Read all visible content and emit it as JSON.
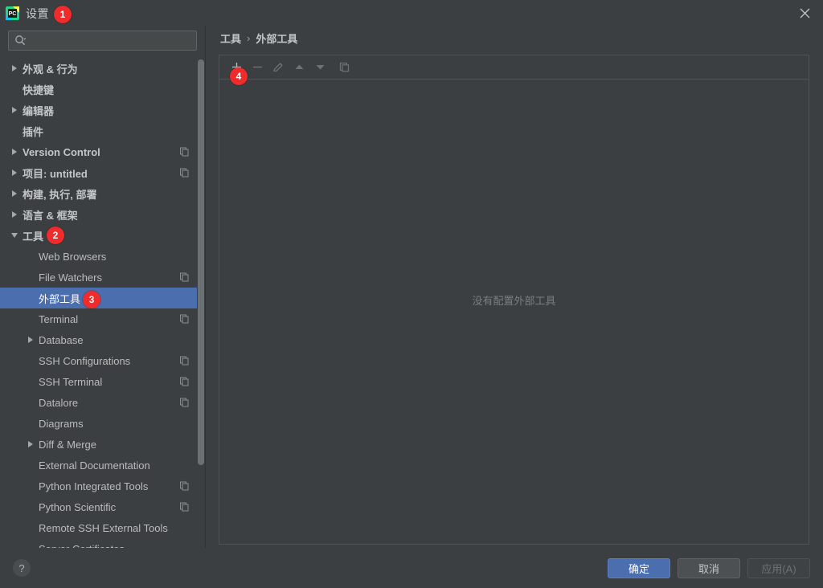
{
  "window": {
    "title": "设置",
    "app_icon": "pycharm-icon",
    "close_label": "✕"
  },
  "search": {
    "value": "",
    "placeholder": "",
    "icon": "search-icon"
  },
  "sidebar": {
    "items": [
      {
        "label": "外观 & 行为",
        "indent": 0,
        "arrow": "right",
        "bold": true,
        "copy": false,
        "selected": false
      },
      {
        "label": "快捷键",
        "indent": 0,
        "arrow": "none",
        "bold": true,
        "copy": false,
        "selected": false
      },
      {
        "label": "编辑器",
        "indent": 0,
        "arrow": "right",
        "bold": true,
        "copy": false,
        "selected": false
      },
      {
        "label": "插件",
        "indent": 0,
        "arrow": "none",
        "bold": true,
        "copy": false,
        "selected": false
      },
      {
        "label": "Version Control",
        "indent": 0,
        "arrow": "right",
        "bold": true,
        "copy": true,
        "selected": false
      },
      {
        "label": "项目: untitled",
        "indent": 0,
        "arrow": "right",
        "bold": true,
        "copy": true,
        "selected": false
      },
      {
        "label": "构建, 执行, 部署",
        "indent": 0,
        "arrow": "right",
        "bold": true,
        "copy": false,
        "selected": false
      },
      {
        "label": "语言 & 框架",
        "indent": 0,
        "arrow": "right",
        "bold": true,
        "copy": false,
        "selected": false
      },
      {
        "label": "工具",
        "indent": 0,
        "arrow": "down",
        "bold": true,
        "copy": false,
        "selected": false
      },
      {
        "label": "Web Browsers",
        "indent": 1,
        "arrow": "none",
        "bold": false,
        "copy": false,
        "selected": false
      },
      {
        "label": "File Watchers",
        "indent": 1,
        "arrow": "none",
        "bold": false,
        "copy": true,
        "selected": false
      },
      {
        "label": "外部工具",
        "indent": 1,
        "arrow": "none",
        "bold": false,
        "copy": false,
        "selected": true
      },
      {
        "label": "Terminal",
        "indent": 1,
        "arrow": "none",
        "bold": false,
        "copy": true,
        "selected": false
      },
      {
        "label": "Database",
        "indent": 1,
        "arrow": "right",
        "bold": false,
        "copy": false,
        "selected": false
      },
      {
        "label": "SSH Configurations",
        "indent": 1,
        "arrow": "none",
        "bold": false,
        "copy": true,
        "selected": false
      },
      {
        "label": "SSH Terminal",
        "indent": 1,
        "arrow": "none",
        "bold": false,
        "copy": true,
        "selected": false
      },
      {
        "label": "Datalore",
        "indent": 1,
        "arrow": "none",
        "bold": false,
        "copy": true,
        "selected": false
      },
      {
        "label": "Diagrams",
        "indent": 1,
        "arrow": "none",
        "bold": false,
        "copy": false,
        "selected": false
      },
      {
        "label": "Diff & Merge",
        "indent": 1,
        "arrow": "right",
        "bold": false,
        "copy": false,
        "selected": false
      },
      {
        "label": "External Documentation",
        "indent": 1,
        "arrow": "none",
        "bold": false,
        "copy": false,
        "selected": false
      },
      {
        "label": "Python Integrated Tools",
        "indent": 1,
        "arrow": "none",
        "bold": false,
        "copy": true,
        "selected": false
      },
      {
        "label": "Python Scientific",
        "indent": 1,
        "arrow": "none",
        "bold": false,
        "copy": true,
        "selected": false
      },
      {
        "label": "Remote SSH External Tools",
        "indent": 1,
        "arrow": "none",
        "bold": false,
        "copy": false,
        "selected": false
      },
      {
        "label": "Server Certificates",
        "indent": 1,
        "arrow": "none",
        "bold": false,
        "copy": false,
        "selected": false
      }
    ]
  },
  "main": {
    "breadcrumb": {
      "parent": "工具",
      "separator": "›",
      "current": "外部工具"
    },
    "toolbar": [
      {
        "name": "add-button",
        "glyph": "plus",
        "enabled": true
      },
      {
        "name": "remove-button",
        "glyph": "minus",
        "enabled": false
      },
      {
        "name": "edit-button",
        "glyph": "pencil",
        "enabled": false
      },
      {
        "name": "move-up-button",
        "glyph": "up",
        "enabled": false
      },
      {
        "name": "move-down-button",
        "glyph": "down",
        "enabled": false
      },
      {
        "name": "copy-button",
        "glyph": "copy",
        "enabled": false
      }
    ],
    "empty_message": "没有配置外部工具"
  },
  "footer": {
    "help_label": "?",
    "ok_label": "确定",
    "cancel_label": "取消",
    "apply_label": "应用(A)"
  },
  "annotations": [
    {
      "id": "1",
      "target": "window-title"
    },
    {
      "id": "2",
      "target": "sidebar-item-tools"
    },
    {
      "id": "3",
      "target": "sidebar-item-external-tools"
    },
    {
      "id": "4",
      "target": "add-button"
    }
  ],
  "colors": {
    "background": "#3c3f41",
    "selection": "#4b6eaf",
    "accent": "#4b6eaf",
    "badge": "#f02b2b",
    "text": "#bbbbbb",
    "muted_text": "#7a7e80"
  }
}
